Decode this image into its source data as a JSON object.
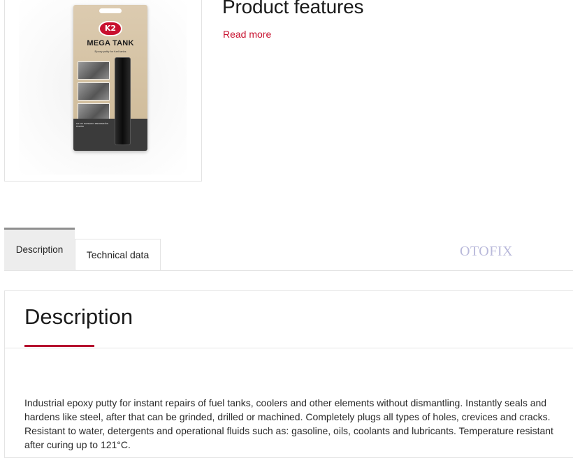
{
  "product": {
    "brand": "K2",
    "name": "MEGA TANK",
    "package_tagline": "Epoxy putty for fuel tanks",
    "package_small_text": [
      "KIT DO NAPRAWY ZBIORNIKÓW PALIWA"
    ]
  },
  "header": {
    "title": "Product features",
    "read_more": "Read more"
  },
  "tabs": [
    {
      "label": "Description",
      "active": true
    },
    {
      "label": "Technical data",
      "active": false
    }
  ],
  "watermark": "OTOFIX",
  "description": {
    "heading": "Description",
    "text": "Industrial epoxy putty for instant repairs of fuel tanks, coolers and other elements without dismantling. Instantly seals and hardens like steel, after that can be grinded, drilled or machined. Completely plugs all types of holes, crevices and cracks. Resistant to water, detergents and operational fluids such as: gasoline, oils, coolants and lubricants. Temperature resistant after curing up to 121°C."
  },
  "colors": {
    "accent": "#c8102e",
    "underline": "#b5122e",
    "active_tab_bg": "#ededed",
    "watermark": "#b8b8da"
  }
}
